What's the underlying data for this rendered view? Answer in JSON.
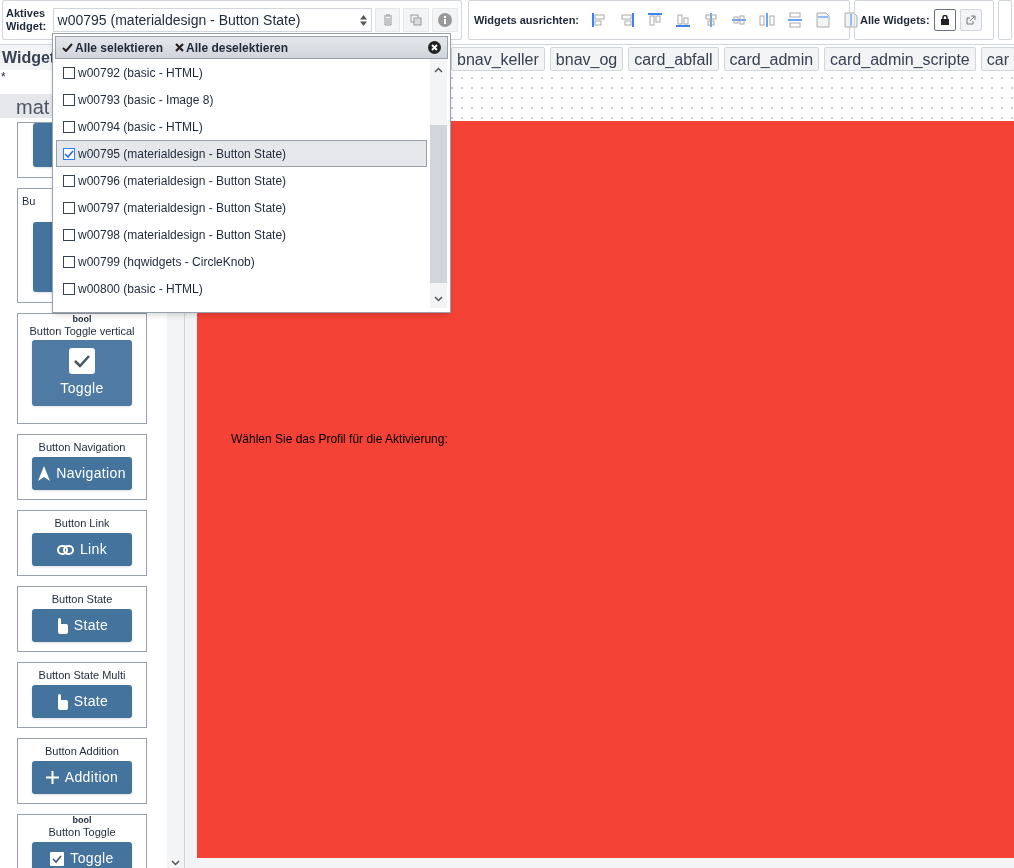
{
  "toolbar": {
    "active_widget_label": "Aktives Widget:",
    "active_widget_value": "w00795 (materialdesign - Button State)",
    "align_label": "Widgets ausrichten:",
    "all_widgets_label": "Alle Widgets:"
  },
  "dropdown": {
    "select_all": "Alle selektieren",
    "deselect_all": "Alle deselektieren",
    "items": [
      {
        "label": "w00792 (basic - HTML)",
        "checked": false,
        "selected": false
      },
      {
        "label": "w00793 (basic - Image 8)",
        "checked": false,
        "selected": false
      },
      {
        "label": "w00794 (basic - HTML)",
        "checked": false,
        "selected": false
      },
      {
        "label": "w00795 (materialdesign - Button State)",
        "checked": true,
        "selected": true
      },
      {
        "label": "w00796 (materialdesign - Button State)",
        "checked": false,
        "selected": false
      },
      {
        "label": "w00797 (materialdesign - Button State)",
        "checked": false,
        "selected": false
      },
      {
        "label": "w00798 (materialdesign - Button State)",
        "checked": false,
        "selected": false
      },
      {
        "label": "w00799 (hqwidgets - CircleKnob)",
        "checked": false,
        "selected": false
      },
      {
        "label": "w00800 (basic - HTML)",
        "checked": false,
        "selected": false
      }
    ]
  },
  "sidebar": {
    "title": "Widget",
    "filter": "*",
    "category": "mat",
    "cards": [
      {
        "kind": "covered"
      },
      {
        "kind": "covered",
        "title": "Bu"
      },
      {
        "kind": "vertical",
        "type": "bool",
        "title": "Button Toggle vertical",
        "button": "Toggle"
      },
      {
        "kind": "inline",
        "title": "Button Navigation",
        "button": "Navigation"
      },
      {
        "kind": "inline",
        "title": "Button Link",
        "button": "Link"
      },
      {
        "kind": "inline",
        "title": "Button State",
        "button": "State"
      },
      {
        "kind": "inline",
        "title": "Button State Multi",
        "button": "State"
      },
      {
        "kind": "inline",
        "title": "Button Addition",
        "button": "Addition"
      },
      {
        "kind": "inline",
        "type": "bool",
        "title": "Button Toggle",
        "button": "Toggle"
      }
    ]
  },
  "view_tabs": [
    "bnav_keller",
    "bnav_og",
    "card_abfall",
    "card_admin",
    "card_admin_scripte",
    "car"
  ],
  "canvas": {
    "text": "Wählen Sie das Profil für die Aktivierung:"
  }
}
